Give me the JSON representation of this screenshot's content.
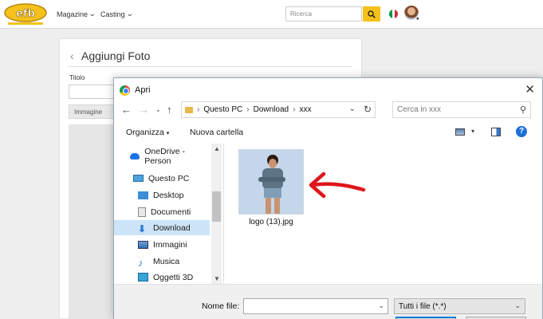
{
  "site": {
    "nav": [
      {
        "label": "Magazine"
      },
      {
        "label": "Casting"
      }
    ],
    "search_placeholder": "Ricerca",
    "flag_colors": [
      "#009246",
      "#ffffff",
      "#ce2b37"
    ]
  },
  "page": {
    "title": "Aggiungi Foto",
    "titolo_label": "Titolo",
    "tab_label": "Immagine"
  },
  "dialog": {
    "title": "Apri",
    "path": [
      "Questo PC",
      "Download",
      "xxx"
    ],
    "search_placeholder": "Cerca in xxx",
    "organize_label": "Organizza",
    "new_folder_label": "Nuova cartella",
    "tree": [
      {
        "label": "OneDrive - Person",
        "icon": "cloud-icon"
      },
      {
        "label": "Questo PC",
        "icon": "computer-icon"
      },
      {
        "label": "Desktop",
        "icon": "desktop-icon"
      },
      {
        "label": "Documenti",
        "icon": "document-icon"
      },
      {
        "label": "Download",
        "icon": "download-icon",
        "selected": true
      },
      {
        "label": "Immagini",
        "icon": "images-icon"
      },
      {
        "label": "Musica",
        "icon": "music-icon"
      },
      {
        "label": "Oggetti 3D",
        "icon": "cube-icon"
      }
    ],
    "files": [
      {
        "name": "logo (13).jpg"
      }
    ],
    "filename_label": "Nome file:",
    "filename_value": "",
    "filter_value": "Tutti i file (*.*)"
  },
  "colors": {
    "accent_yellow": "#f6c118",
    "selection": "#cce4f7",
    "annotation_red": "#e0161b"
  }
}
